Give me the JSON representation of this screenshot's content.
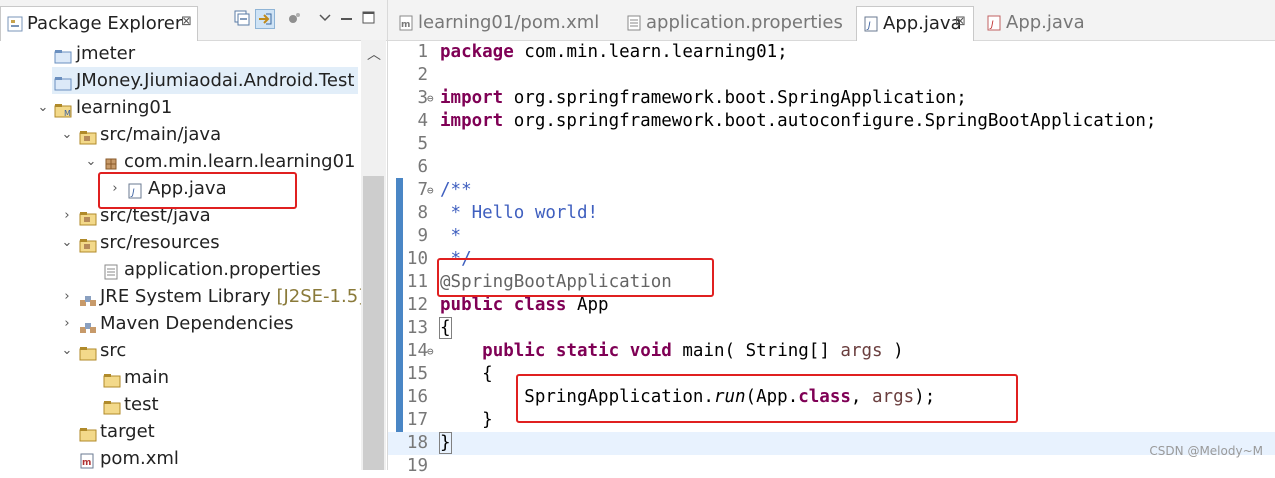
{
  "package_explorer": {
    "title": "Package Explorer",
    "close": "⊠",
    "tree": [
      {
        "label": "jmeter",
        "deco": "",
        "icon": "project-folder-icon",
        "twisty": "",
        "depth": 1
      },
      {
        "label": "JMoney.Jiumiaodai.Android.Test",
        "deco": "",
        "icon": "project-folder-icon",
        "twisty": "",
        "depth": 1
      },
      {
        "label": "learning01",
        "deco": "",
        "icon": "maven-project-icon",
        "twisty": "expanded",
        "depth": 1
      },
      {
        "label": "src/main/java",
        "deco": "",
        "icon": "source-folder-icon",
        "twisty": "expanded",
        "depth": 2
      },
      {
        "label": "com.min.learn.learning01",
        "deco": "",
        "icon": "package-icon",
        "twisty": "expanded",
        "depth": 3
      },
      {
        "label": "App.java",
        "deco": "",
        "icon": "java-file-icon",
        "twisty": "collapsed",
        "depth": 4
      },
      {
        "label": "src/test/java",
        "deco": "",
        "icon": "source-folder-icon",
        "twisty": "collapsed",
        "depth": 2
      },
      {
        "label": "src/resources",
        "deco": "",
        "icon": "source-folder-icon",
        "twisty": "expanded",
        "depth": 2
      },
      {
        "label": "application.properties",
        "deco": "",
        "icon": "properties-file-icon",
        "twisty": "",
        "depth": 3
      },
      {
        "label": "JRE System Library",
        "deco": "[J2SE-1.5]",
        "icon": "library-icon",
        "twisty": "collapsed",
        "depth": 2
      },
      {
        "label": "Maven Dependencies",
        "deco": "",
        "icon": "library-icon",
        "twisty": "collapsed",
        "depth": 2
      },
      {
        "label": "src",
        "deco": "",
        "icon": "folder-icon",
        "twisty": "expanded",
        "depth": 2
      },
      {
        "label": "main",
        "deco": "",
        "icon": "folder-icon",
        "twisty": "",
        "depth": 3
      },
      {
        "label": "test",
        "deco": "",
        "icon": "folder-icon",
        "twisty": "",
        "depth": 3
      },
      {
        "label": "target",
        "deco": "",
        "icon": "folder-icon",
        "twisty": "",
        "depth": 2
      },
      {
        "label": "pom.xml",
        "deco": "",
        "icon": "xml-file-icon",
        "twisty": "",
        "depth": 2
      }
    ]
  },
  "editor": {
    "tabs": [
      {
        "label": "learning01/pom.xml",
        "icon": "maven-pom-icon",
        "active": false
      },
      {
        "label": "application.properties",
        "icon": "properties-file-icon",
        "active": false
      },
      {
        "label": "App.java",
        "icon": "java-file-icon",
        "active": true,
        "close": "⊠"
      },
      {
        "label": "App.java",
        "icon": "java-file-error-icon",
        "active": false
      }
    ],
    "current_line": 18,
    "lines": [
      {
        "n": "1",
        "fold": "",
        "segs": [
          {
            "t": "package",
            "c": "kw"
          },
          {
            "t": " com.min.learn.learning01;",
            "c": ""
          }
        ]
      },
      {
        "n": "2",
        "fold": "",
        "segs": []
      },
      {
        "n": "3",
        "fold": "⊖",
        "segs": [
          {
            "t": "import",
            "c": "kw"
          },
          {
            "t": " org.springframework.boot.SpringApplication;",
            "c": ""
          }
        ]
      },
      {
        "n": "4",
        "fold": "",
        "segs": [
          {
            "t": "import",
            "c": "kw"
          },
          {
            "t": " org.springframework.boot.autoconfigure.SpringBootApplication;",
            "c": ""
          }
        ]
      },
      {
        "n": "5",
        "fold": "",
        "segs": []
      },
      {
        "n": "6",
        "fold": "",
        "segs": []
      },
      {
        "n": "7",
        "fold": "⊖",
        "segs": [
          {
            "t": "/**",
            "c": "cm"
          }
        ]
      },
      {
        "n": "8",
        "fold": "",
        "segs": [
          {
            "t": " * Hello world!",
            "c": "cm"
          }
        ]
      },
      {
        "n": "9",
        "fold": "",
        "segs": [
          {
            "t": " *",
            "c": "cm"
          }
        ]
      },
      {
        "n": "10",
        "fold": "",
        "segs": [
          {
            "t": " */",
            "c": "cm"
          }
        ]
      },
      {
        "n": "11",
        "fold": "",
        "segs": [
          {
            "t": "@SpringBootApplication",
            "c": "an"
          }
        ]
      },
      {
        "n": "12",
        "fold": "",
        "segs": [
          {
            "t": "public",
            "c": "kw"
          },
          {
            "t": " ",
            "c": ""
          },
          {
            "t": "class",
            "c": "kw"
          },
          {
            "t": " App",
            "c": ""
          }
        ]
      },
      {
        "n": "13",
        "fold": "",
        "segs": [
          {
            "t": "{",
            "c": "brk"
          }
        ]
      },
      {
        "n": "14",
        "fold": "⊖",
        "segs": [
          {
            "t": "    ",
            "c": ""
          },
          {
            "t": "public",
            "c": "kw"
          },
          {
            "t": " ",
            "c": ""
          },
          {
            "t": "static",
            "c": "kw"
          },
          {
            "t": " ",
            "c": ""
          },
          {
            "t": "void",
            "c": "kw"
          },
          {
            "t": " main( String[] ",
            "c": ""
          },
          {
            "t": "args",
            "c": "va"
          },
          {
            "t": " )",
            "c": ""
          }
        ]
      },
      {
        "n": "15",
        "fold": "",
        "segs": [
          {
            "t": "    {",
            "c": ""
          }
        ]
      },
      {
        "n": "16",
        "fold": "",
        "segs": [
          {
            "t": "        SpringApplication.",
            "c": ""
          },
          {
            "t": "run",
            "c": "it"
          },
          {
            "t": "(App.",
            "c": ""
          },
          {
            "t": "class",
            "c": "kw"
          },
          {
            "t": ", ",
            "c": ""
          },
          {
            "t": "args",
            "c": "va"
          },
          {
            "t": ");",
            "c": ""
          }
        ]
      },
      {
        "n": "17",
        "fold": "",
        "segs": [
          {
            "t": "    }",
            "c": ""
          }
        ]
      },
      {
        "n": "18",
        "fold": "",
        "segs": [
          {
            "t": "}",
            "c": "brk"
          }
        ]
      },
      {
        "n": "19",
        "fold": "",
        "segs": []
      }
    ]
  },
  "watermark": "CSDN @Melody~M",
  "colors": {
    "highlight_box": "#e02020",
    "keyword": "#7f0055",
    "javadoc": "#3f5fbf",
    "annotation": "#646464"
  }
}
